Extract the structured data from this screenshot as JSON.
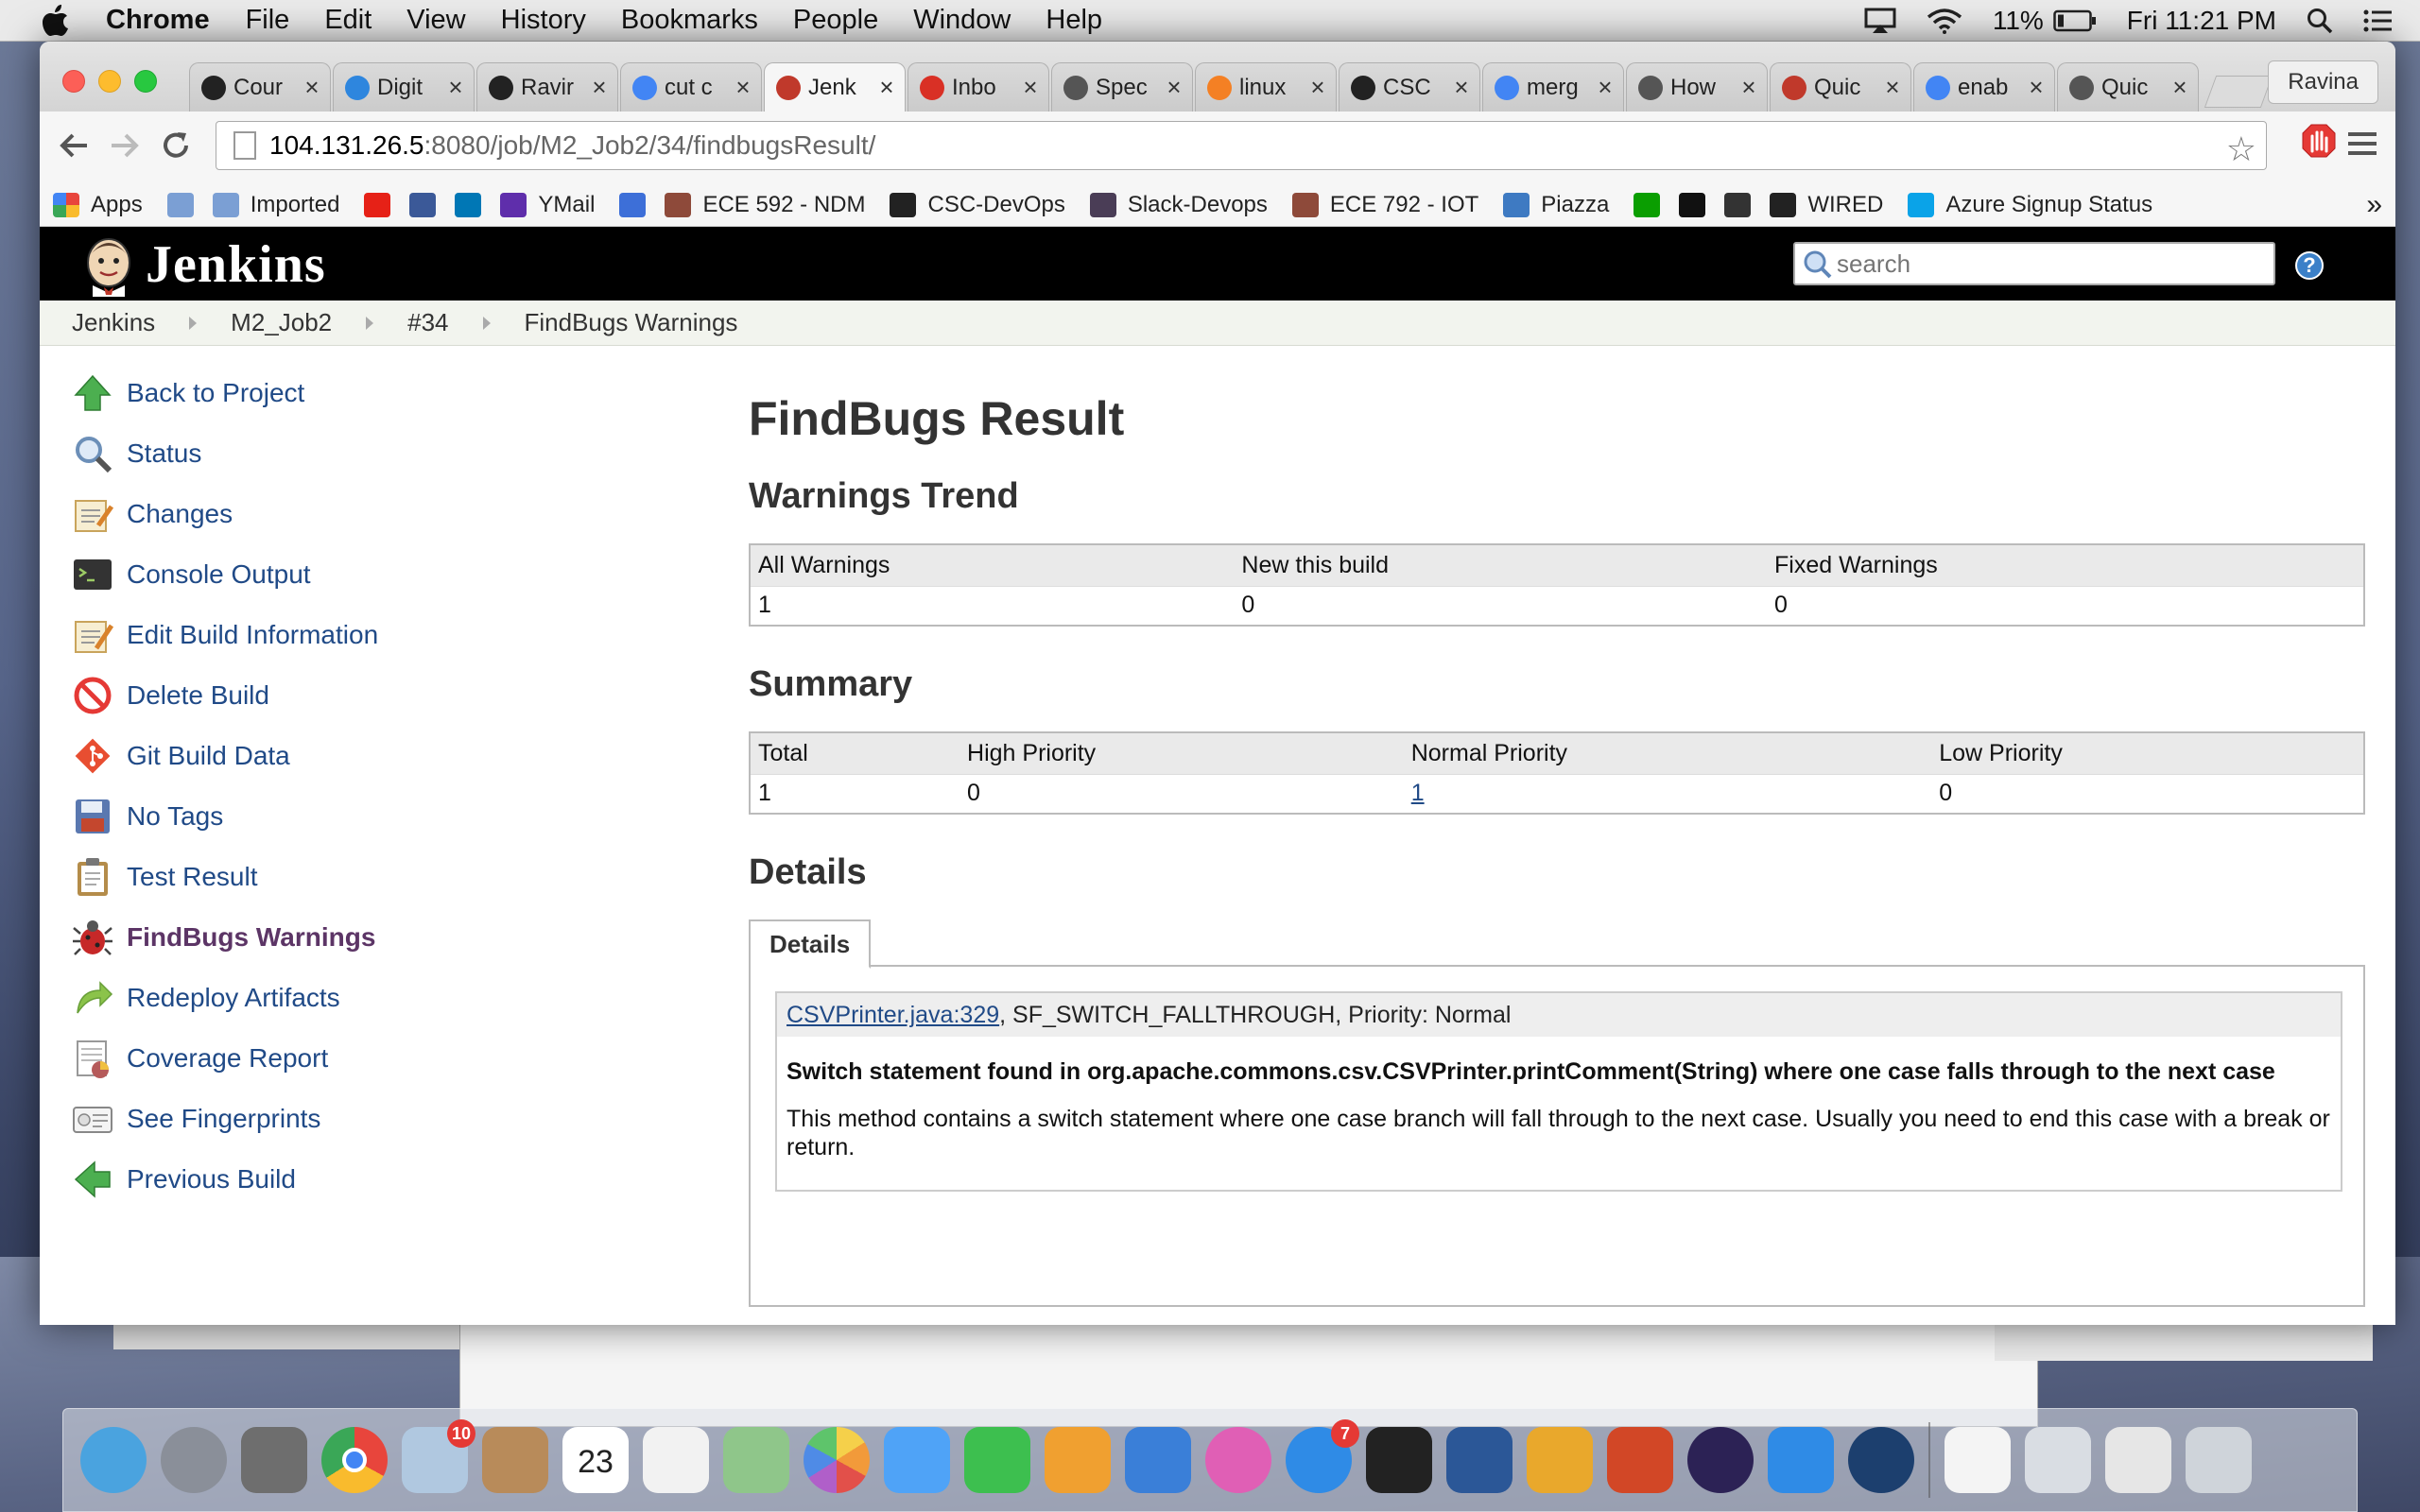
{
  "menubar": {
    "app_name": "Chrome",
    "items": [
      "File",
      "Edit",
      "View",
      "History",
      "Bookmarks",
      "People",
      "Window",
      "Help"
    ],
    "battery": "11%",
    "clock": "Fri 11:21 PM"
  },
  "browser": {
    "profile": "Ravina",
    "tabs": [
      {
        "title": "Cour",
        "icon": "github-icon",
        "color": "#222222"
      },
      {
        "title": "Digit",
        "icon": "cloud-icon",
        "color": "#2e86de"
      },
      {
        "title": "Ravir",
        "icon": "github-icon",
        "color": "#222222"
      },
      {
        "title": "cut c",
        "icon": "google-icon",
        "color": "#4285f4"
      },
      {
        "title": "Jenk",
        "icon": "jenkins-icon",
        "color": "#c0392b",
        "active": true
      },
      {
        "title": "Inbo",
        "icon": "gmail-icon",
        "color": "#d93025"
      },
      {
        "title": "Spec",
        "icon": "apple-icon",
        "color": "#555555"
      },
      {
        "title": "linux",
        "icon": "stackoverflow-icon",
        "color": "#f48024"
      },
      {
        "title": "CSC",
        "icon": "github-icon",
        "color": "#222222"
      },
      {
        "title": "merg",
        "icon": "google-icon",
        "color": "#4285f4"
      },
      {
        "title": "How",
        "icon": "apple-icon",
        "color": "#555555"
      },
      {
        "title": "Quic",
        "icon": "quickbooks-icon",
        "color": "#c0392b"
      },
      {
        "title": "enab",
        "icon": "google-icon",
        "color": "#4285f4"
      },
      {
        "title": "Quic",
        "icon": "apple-icon",
        "color": "#555555"
      }
    ],
    "url_host": "104.131.26.5",
    "url_path": ":8080/job/M2_Job2/34/findbugsResult/",
    "bookmarks": [
      {
        "label": "Apps",
        "icon": "apps-grid-icon",
        "color": "#e8453c"
      },
      {
        "label": "",
        "icon": "folder-icon",
        "color": "#7b9fd4"
      },
      {
        "label": "Imported",
        "icon": "folder-icon",
        "color": "#7b9fd4"
      },
      {
        "label": "",
        "icon": "youtube-icon",
        "color": "#e62117"
      },
      {
        "label": "",
        "icon": "facebook-icon",
        "color": "#3b5998"
      },
      {
        "label": "",
        "icon": "linkedin-icon",
        "color": "#0077b5"
      },
      {
        "label": "YMail",
        "icon": "mail-icon",
        "color": "#5f2eab"
      },
      {
        "label": "",
        "icon": "infinity-icon",
        "color": "#3d6fd8"
      },
      {
        "label": "ECE 592 - NDM",
        "icon": "avatar-icon",
        "color": "#8e4a3a"
      },
      {
        "label": "CSC-DevOps",
        "icon": "github-icon",
        "color": "#222222"
      },
      {
        "label": "Slack-Devops",
        "icon": "slack-icon",
        "color": "#4a3d56"
      },
      {
        "label": "ECE 792 - IOT",
        "icon": "avatar-icon",
        "color": "#8e4a3a"
      },
      {
        "label": "Piazza",
        "icon": "piazza-icon",
        "color": "#3e7ac2"
      },
      {
        "label": "",
        "icon": "techcrunch-icon",
        "color": "#0a9e01"
      },
      {
        "label": "",
        "icon": "medium-icon",
        "color": "#111111"
      },
      {
        "label": "",
        "icon": "htg-icon",
        "color": "#333333"
      },
      {
        "label": "WIRED",
        "icon": "wired-icon",
        "color": "#222222"
      },
      {
        "label": "Azure Signup Status",
        "icon": "windows-icon",
        "color": "#0aa3e8"
      }
    ]
  },
  "jenkins": {
    "title": "Jenkins",
    "search_placeholder": "search",
    "help": "?",
    "breadcrumbs": [
      "Jenkins",
      "M2_Job2",
      "#34",
      "FindBugs Warnings"
    ],
    "sidebar": [
      {
        "label": "Back to Project",
        "icon": "up-arrow-icon",
        "color": "#4caf50"
      },
      {
        "label": "Status",
        "icon": "magnifier-icon",
        "color": "#6c8fb8"
      },
      {
        "label": "Changes",
        "icon": "notepad-icon",
        "color": "#c9a45c"
      },
      {
        "label": "Console Output",
        "icon": "terminal-icon",
        "color": "#333333"
      },
      {
        "label": "Edit Build Information",
        "icon": "notepad-pencil-icon",
        "color": "#c9a45c"
      },
      {
        "label": "Delete Build",
        "icon": "no-entry-icon",
        "color": "#e53935"
      },
      {
        "label": "Git Build Data",
        "icon": "git-icon",
        "color": "#e84e31"
      },
      {
        "label": "No Tags",
        "icon": "floppy-icon",
        "color": "#5a78b0"
      },
      {
        "label": "Test Result",
        "icon": "clipboard-icon",
        "color": "#b48c4a"
      },
      {
        "label": "FindBugs Warnings",
        "icon": "bug-icon",
        "color": "#c62828",
        "current": true
      },
      {
        "label": "Redeploy Artifacts",
        "icon": "redeploy-arrow-icon",
        "color": "#8bc34a"
      },
      {
        "label": "Coverage Report",
        "icon": "report-icon",
        "color": "#b55a5a"
      },
      {
        "label": "See Fingerprints",
        "icon": "fingerprint-card-icon",
        "color": "#888888"
      },
      {
        "label": "Previous Build",
        "icon": "left-arrow-icon",
        "color": "#4caf50"
      }
    ],
    "heading": "FindBugs Result",
    "trend": {
      "heading": "Warnings Trend",
      "headers": [
        "All Warnings",
        "New this build",
        "Fixed Warnings"
      ],
      "values": [
        "1",
        "0",
        "0"
      ]
    },
    "summary": {
      "heading": "Summary",
      "headers": [
        "Total",
        "High Priority",
        "Normal Priority",
        "Low Priority"
      ],
      "values": [
        "1",
        "0",
        "1",
        "0"
      ]
    },
    "details": {
      "heading": "Details",
      "tab": "Details",
      "file_link": "CSVPrinter.java:329",
      "meta": ", SF_SWITCH_FALLTHROUGH, Priority: Normal",
      "message": "Switch statement found in org.apache.commons.csv.CSVPrinter.printComment(String) where one case falls through to the next case",
      "description": "This method contains a switch statement where one case branch will fall through to the next case. Usually you need to end this case with a break or return."
    }
  },
  "dock": [
    {
      "name": "finder-icon",
      "color": "#4aa3df"
    },
    {
      "name": "launchpad-icon",
      "color": "#8a8f99"
    },
    {
      "name": "system-preferences-icon",
      "color": "#6e6e6e"
    },
    {
      "name": "chrome-icon",
      "color": "#e8453c"
    },
    {
      "name": "mail-icon",
      "color": "#b0c8e0",
      "badge": "10"
    },
    {
      "name": "contacts-icon",
      "color": "#b88b5a"
    },
    {
      "name": "calendar-icon",
      "color": "#ffffff",
      "text": "23"
    },
    {
      "name": "reminders-icon",
      "color": "#f2f2f2"
    },
    {
      "name": "maps-icon",
      "color": "#8fc68a"
    },
    {
      "name": "photos-icon",
      "color": "#f5d04a"
    },
    {
      "name": "messages-icon",
      "color": "#4fa3f7"
    },
    {
      "name": "facetime-icon",
      "color": "#3dbf4f"
    },
    {
      "name": "pages-icon",
      "color": "#f0a030"
    },
    {
      "name": "keynote-icon",
      "color": "#3a7fd8"
    },
    {
      "name": "itunes-icon",
      "color": "#e05fb5"
    },
    {
      "name": "app-store-icon",
      "color": "#2f8be6",
      "badge": "7"
    },
    {
      "name": "terminal-icon",
      "color": "#222222"
    },
    {
      "name": "word-icon",
      "color": "#2b5797"
    },
    {
      "name": "slack-icon",
      "color": "#e9a82c"
    },
    {
      "name": "powerpoint-icon",
      "color": "#d24726"
    },
    {
      "name": "eclipse-icon",
      "color": "#2c2255"
    },
    {
      "name": "xcode-icon",
      "color": "#2f8be6"
    },
    {
      "name": "quicktime-icon",
      "color": "#1c3f6e"
    },
    {
      "name": "separator"
    },
    {
      "name": "document-icon",
      "color": "#f4f4f4"
    },
    {
      "name": "presentation-thumb-icon",
      "color": "#d9dde3"
    },
    {
      "name": "window-thumb-icon",
      "color": "#e6e6e6"
    },
    {
      "name": "trash-icon",
      "color": "#cfd4da"
    }
  ]
}
